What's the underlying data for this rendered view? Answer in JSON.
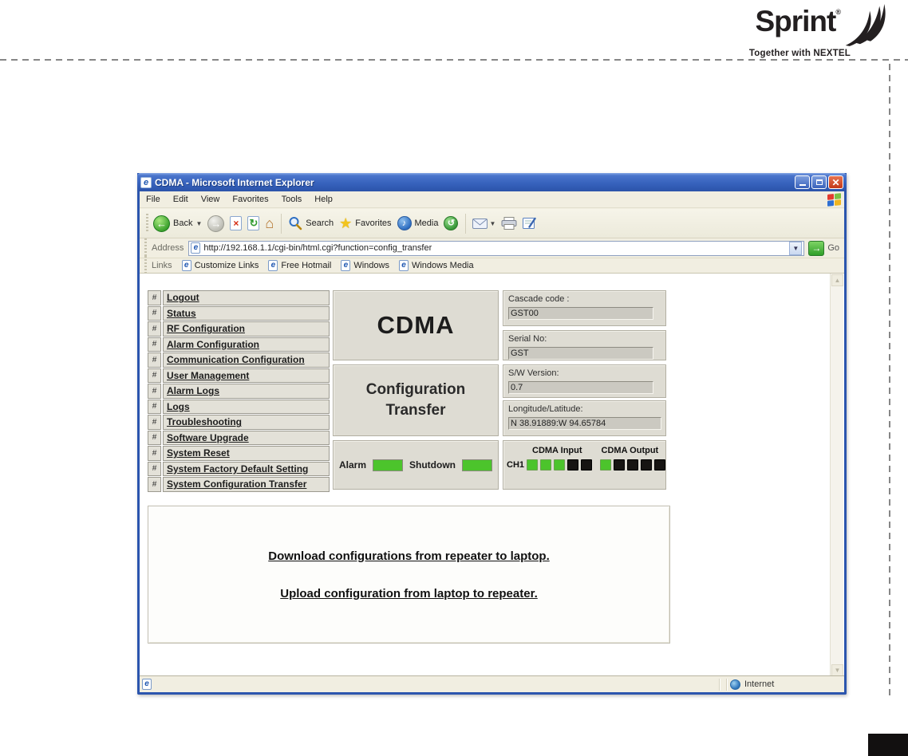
{
  "brand": {
    "name": "Sprint",
    "registered": "®",
    "tagline": "Together with NEXTEL"
  },
  "browser": {
    "title": "CDMA - Microsoft Internet Explorer",
    "menu_items": [
      "File",
      "Edit",
      "View",
      "Favorites",
      "Tools",
      "Help"
    ],
    "toolbar": {
      "back_label": "Back",
      "search_label": "Search",
      "favorites_label": "Favorites",
      "media_label": "Media"
    },
    "address_bar": {
      "label": "Address",
      "url": "http://192.168.1.1/cgi-bin/html.cgi?function=config_transfer",
      "go_label": "Go"
    },
    "links_bar": {
      "label": "Links",
      "links": [
        "Customize Links",
        "Free Hotmail",
        "Windows",
        "Windows Media"
      ]
    },
    "status_bar": {
      "zone": "Internet"
    }
  },
  "app": {
    "sidebar": {
      "prefix": "#",
      "items": [
        "Logout",
        "Status",
        "RF Configuration",
        "Alarm Configuration",
        "Communication Configuration",
        "User Management",
        "Alarm Logs",
        "Logs",
        "Troubleshooting",
        "Software Upgrade",
        "System Reset",
        "System Factory Default Setting",
        "System Configuration Transfer"
      ]
    },
    "header": {
      "title": "CDMA",
      "subtitle_line1": "Configuration",
      "subtitle_line2": "Transfer"
    },
    "fields": [
      {
        "label": "Cascade code :",
        "value": "GST00"
      },
      {
        "label": "Serial No:",
        "value": "GST"
      },
      {
        "label": "S/W Version:",
        "value": "0.7"
      },
      {
        "label": "Longitude/Latitude:",
        "value": "N 38.91889:W 94.65784"
      }
    ],
    "indicators": {
      "alarm_label": "Alarm",
      "alarm_state": "on",
      "shutdown_label": "Shutdown",
      "shutdown_state": "on",
      "input_header": "CDMA Input",
      "output_header": "CDMA Output",
      "channel_label": "CH1",
      "input_leds": [
        "on",
        "on",
        "on",
        "off",
        "off"
      ],
      "output_leds": [
        "on",
        "off",
        "off",
        "off",
        "off"
      ]
    },
    "main_links": [
      "Download configurations from repeater to laptop.",
      "Upload configuration from laptop to repeater."
    ],
    "colors": {
      "led_on": "#4cc42c",
      "led_off": "#161412"
    }
  }
}
